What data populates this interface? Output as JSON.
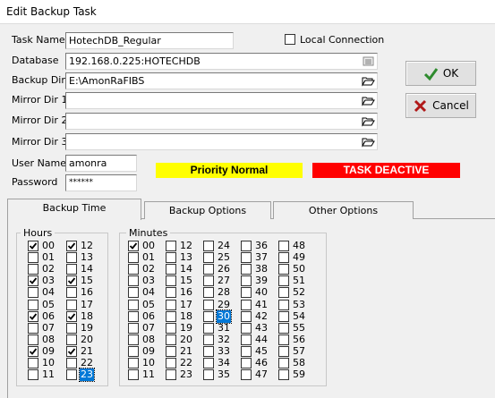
{
  "window": {
    "title": "Edit Backup Task"
  },
  "form": {
    "task_name_label": "Task Name",
    "task_name_value": "HotechDB_Regular",
    "local_connection_label": "Local Connection",
    "local_connection_checked": false,
    "database_label": "Database",
    "database_value": "192.168.0.225:HOTECHDB",
    "backup_dir_label": "Backup Dir",
    "backup_dir_value": "E:\\AmonRaFIBS",
    "mirror1_label": "Mirror Dir 1",
    "mirror1_value": "",
    "mirror2_label": "Mirror Dir 2",
    "mirror2_value": "",
    "mirror3_label": "Mirror Dir 3",
    "mirror3_value": "",
    "username_label": "User Name",
    "username_value": "amonra",
    "password_label": "Password",
    "password_value": "******"
  },
  "buttons": {
    "ok_label": "OK",
    "cancel_label": "Cancel"
  },
  "status": {
    "priority_text": "Priority Normal",
    "priority_color": "#ffff00",
    "task_text": "TASK DEACTIVE",
    "task_color": "#ff0000"
  },
  "tabs": [
    {
      "label": "Backup Time",
      "active": true
    },
    {
      "label": "Backup Options",
      "active": false
    },
    {
      "label": "Other Options",
      "active": false
    }
  ],
  "hours": {
    "title": "Hours",
    "columns": [
      [
        "00",
        "01",
        "02",
        "03",
        "04",
        "05",
        "06",
        "07",
        "08",
        "09",
        "10",
        "11"
      ],
      [
        "12",
        "13",
        "14",
        "15",
        "16",
        "17",
        "18",
        "19",
        "20",
        "21",
        "22",
        "23"
      ]
    ],
    "checked": [
      "00",
      "03",
      "06",
      "09",
      "12",
      "15",
      "18",
      "21"
    ],
    "focused": "23"
  },
  "minutes": {
    "title": "Minutes",
    "columns": [
      [
        "00",
        "01",
        "02",
        "03",
        "04",
        "05",
        "06",
        "07",
        "08",
        "09",
        "10",
        "11"
      ],
      [
        "12",
        "13",
        "14",
        "15",
        "16",
        "17",
        "18",
        "19",
        "20",
        "21",
        "22",
        "23"
      ],
      [
        "24",
        "25",
        "26",
        "27",
        "28",
        "29",
        "30",
        "31",
        "32",
        "33",
        "34",
        "35"
      ],
      [
        "36",
        "37",
        "38",
        "39",
        "40",
        "41",
        "42",
        "43",
        "44",
        "45",
        "46",
        "47"
      ],
      [
        "48",
        "49",
        "50",
        "51",
        "52",
        "53",
        "54",
        "55",
        "56",
        "57",
        "58",
        "59"
      ]
    ],
    "checked": [
      "00"
    ],
    "focused": "30"
  },
  "icons": {
    "database_browse": "list-icon",
    "folder_browse": "folder-open-icon",
    "ok": "checkmark-icon",
    "cancel": "x-icon"
  }
}
